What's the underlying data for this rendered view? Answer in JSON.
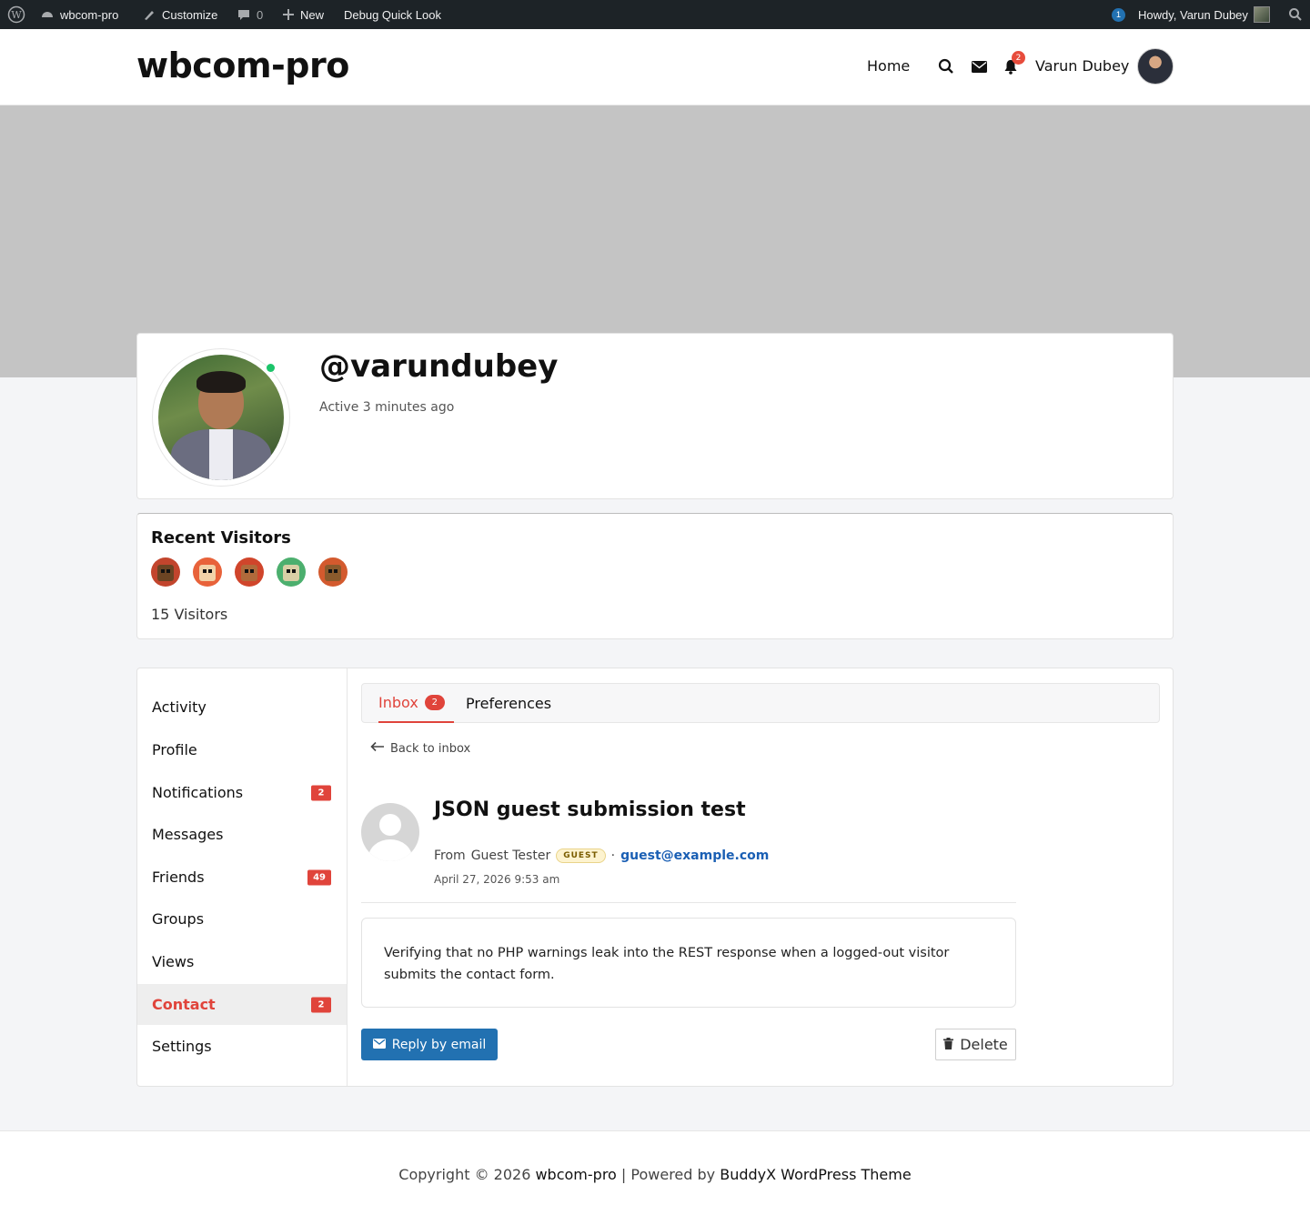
{
  "admin_bar": {
    "site": "wbcom-pro",
    "customize": "Customize",
    "comments_count": "0",
    "new": "New",
    "debug": "Debug Quick Look",
    "updates_count": "1",
    "howdy": "Howdy, Varun Dubey"
  },
  "header": {
    "site_title": "wbcom-pro",
    "nav_home": "Home",
    "notifications_count": "2",
    "user_name": "Varun Dubey"
  },
  "profile": {
    "username": "@varundubey",
    "status": "Active 3 minutes ago"
  },
  "visitors": {
    "title": "Recent Visitors",
    "count_label": "15  Visitors",
    "avatars": [
      {
        "bg": "#c2452d",
        "face": "#6b4423"
      },
      {
        "bg": "#e8623a",
        "face": "#f2d2a8"
      },
      {
        "bg": "#d0452b",
        "face": "#b06a3b"
      },
      {
        "bg": "#4caf6e",
        "face": "#d9cfa5"
      },
      {
        "bg": "#d35a2e",
        "face": "#8a5a2c"
      }
    ]
  },
  "sidebar": {
    "items": [
      {
        "label": "Activity",
        "badge": ""
      },
      {
        "label": "Profile",
        "badge": ""
      },
      {
        "label": "Notifications",
        "badge": "2"
      },
      {
        "label": "Messages",
        "badge": ""
      },
      {
        "label": "Friends",
        "badge": "49"
      },
      {
        "label": "Groups",
        "badge": ""
      },
      {
        "label": "Views",
        "badge": ""
      },
      {
        "label": "Contact",
        "badge": "2"
      },
      {
        "label": "Settings",
        "badge": ""
      }
    ]
  },
  "tabs": {
    "inbox": "Inbox",
    "inbox_count": "2",
    "preferences": "Preferences"
  },
  "message": {
    "back": "Back to inbox",
    "subject": "JSON guest submission test",
    "from_label": "From",
    "from_name": "Guest Tester",
    "guest_badge": "GUEST",
    "separator": "·",
    "email": "guest@example.com",
    "date": "April 27, 2026 9:53 am",
    "body": "Verifying that no PHP warnings leak into the REST response when a logged-out visitor submits the contact form.",
    "reply_label": "Reply by email",
    "delete_label": "Delete"
  },
  "footer": {
    "prefix": "Copyright © 2026",
    "site": "wbcom-pro",
    "mid": "| Powered by",
    "theme": "BuddyX WordPress Theme"
  },
  "colors": {
    "accent": "#e0443b",
    "primary_button": "#2271b1",
    "admin_bar": "#1d2327",
    "cover": "#c4c4c4"
  }
}
